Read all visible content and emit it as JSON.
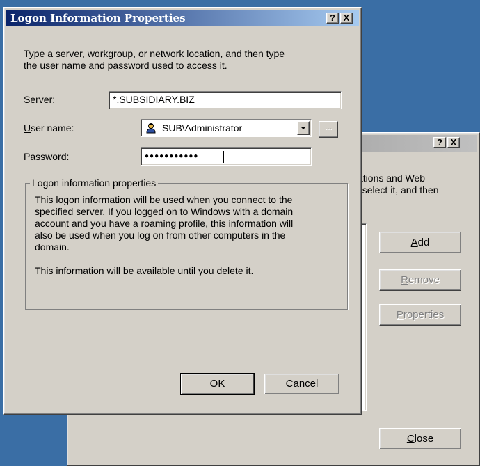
{
  "dialog": {
    "title": "Logon Information Properties",
    "help_label": "?",
    "close_label": "X",
    "intro_line1": "Type a server, workgroup, or network location, and then type",
    "intro_line2": "the user name and password used to access it.",
    "server": {
      "label_access": "S",
      "label_rest": "erver:",
      "value": "*.SUBSIDIARY.BIZ"
    },
    "user_name": {
      "label_access": "U",
      "label_rest": "ser name:",
      "value": "SUB\\Administrator",
      "browse_label": "..."
    },
    "password": {
      "label_access": "P",
      "label_rest": "assword:",
      "value": "●●●●●●●●●●●"
    },
    "group": {
      "legend": "Logon information properties",
      "line1": "This logon information will be used when you connect to the",
      "line2": "specified server. If you logged on to Windows with a domain",
      "line3": "account and you have a roaming profile, this information will",
      "line4": "also be used when you log on from other computers in the",
      "line5": "domain.",
      "line6": "This information will be available until you delete it."
    },
    "ok_label": "OK",
    "cancel_label": "Cancel"
  },
  "background_dialog": {
    "help_label": "?",
    "close_label": "X",
    "text_line1": "cations and Web",
    "text_line2": "y, select it, and then",
    "add": {
      "access": "A",
      "rest": "dd"
    },
    "remove": {
      "access": "R",
      "rest": "emove"
    },
    "properties": {
      "access": "P",
      "rest": "roperties"
    },
    "close": {
      "access": "C",
      "rest": "lose"
    }
  },
  "colors": {
    "desktop": "#3a6ea5",
    "active_title_start": "#0a246a",
    "active_title_end": "#a6caf0",
    "face": "#d4d0c8"
  },
  "icons": {
    "user": "user-icon",
    "dropdown": "chevron-down-icon"
  }
}
